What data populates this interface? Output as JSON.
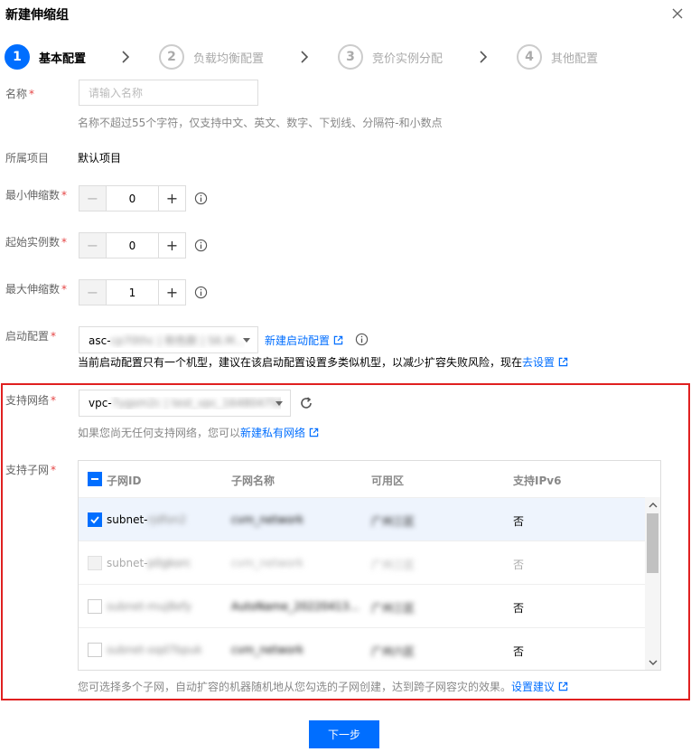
{
  "dialog": {
    "title": "新建伸缩组",
    "next_label": "下一步"
  },
  "steps": [
    {
      "num": "1",
      "label": "基本配置",
      "active": true
    },
    {
      "num": "2",
      "label": "负载均衡配置",
      "active": false
    },
    {
      "num": "3",
      "label": "竞价实例分配",
      "active": false
    },
    {
      "num": "4",
      "label": "其他配置",
      "active": false
    }
  ],
  "name_field": {
    "label": "名称",
    "placeholder": "请输入名称",
    "hint": "名称不超过55个字符，仅支持中文、英文、数字、下划线、分隔符-和小数点"
  },
  "project": {
    "label": "所属项目",
    "value": "默认项目"
  },
  "min_size": {
    "label": "最小伸缩数",
    "value": "0"
  },
  "initial_count": {
    "label": "起始实例数",
    "value": "0"
  },
  "max_size": {
    "label": "最大伸缩数",
    "value": "1"
  },
  "launch_config": {
    "label": "启动配置",
    "value_prefix": "asc-",
    "value_blur": "cp70thc | 粉色默 | S6.M...",
    "new_link": "新建启动配置",
    "notice": "当前启动配置只有一个机型，建议在该启动配置设置多类似机型，以减少扩容失败风险，现在",
    "notice_link": "去设置"
  },
  "vpc": {
    "label": "支持网络",
    "value_prefix": "vpc-",
    "value_blur": "7ygsm2c | test_vpc_1648047585",
    "hint": "如果您尚无任何支持网络，您可以",
    "hint_link": "新建私有网络"
  },
  "subnets": {
    "label": "支持子网",
    "headers": {
      "id": "子网ID",
      "name": "子网名称",
      "zone": "可用区",
      "ipv6": "支持IPv6"
    },
    "rows": [
      {
        "id_prefix": "subnet-",
        "id_blur": "rjdfon2",
        "name": "cvm_network",
        "zone": "广州三区",
        "ipv6": "否",
        "checked": true,
        "disabled": false
      },
      {
        "id_prefix": "subnet-",
        "id_blur": "p0gkorc",
        "name": "cvm_network",
        "zone": "广州三区",
        "ipv6": "否",
        "checked": false,
        "disabled": true
      },
      {
        "id_prefix": "",
        "id_blur": "subnet-muj8efy",
        "name": "AutoName_20220413...",
        "zone": "广州三区",
        "ipv6": "否",
        "checked": false,
        "disabled": false
      },
      {
        "id_prefix": "",
        "id_blur": "subnet-oqd7bpuk",
        "name": "cvm_network",
        "zone": "广州六区",
        "ipv6": "否",
        "checked": false,
        "disabled": false
      }
    ],
    "footer": "您可选择多个子网，自动扩容的机器随机地从您勾选的子网创建，达到跨子网容灾的效果。",
    "footer_link": "设置建议"
  }
}
